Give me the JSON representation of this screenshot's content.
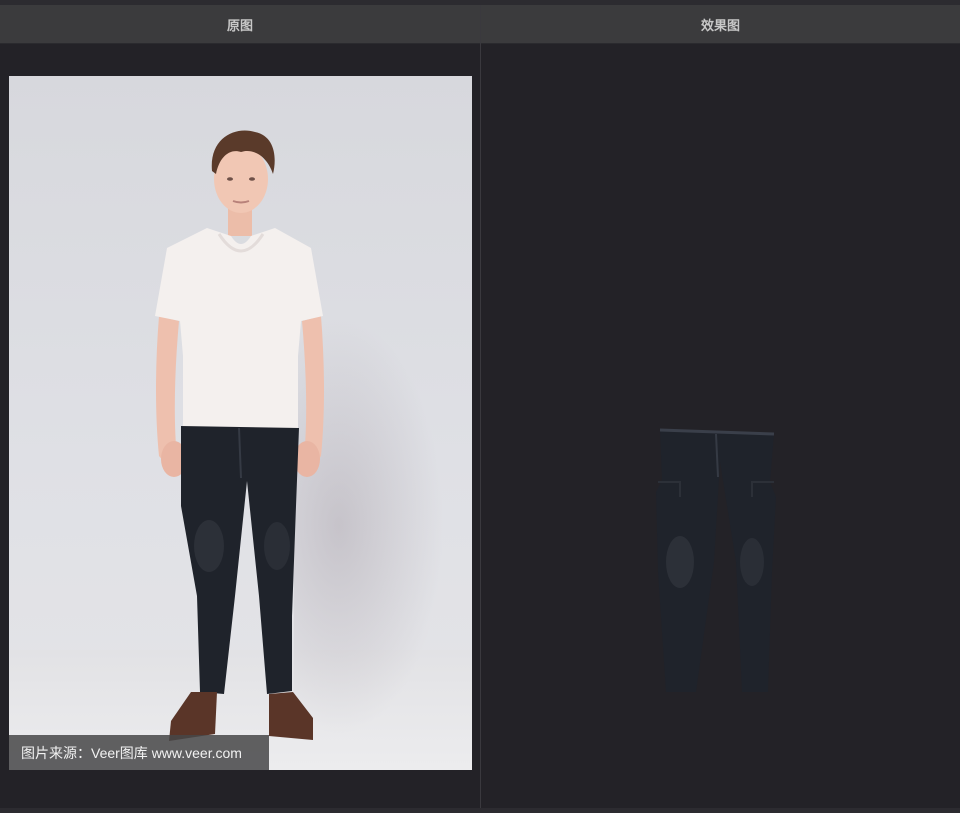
{
  "panels": {
    "left": {
      "title": "原图"
    },
    "right": {
      "title": "效果图"
    }
  },
  "photo": {
    "watermark": "图片来源：Veer图库 www.veer.com"
  },
  "colors": {
    "background": "#232227",
    "header": "#3b3b3d",
    "header_text": "#c8c8c8",
    "jeans": "#1f232b",
    "shirt": "#f4f0ee"
  }
}
